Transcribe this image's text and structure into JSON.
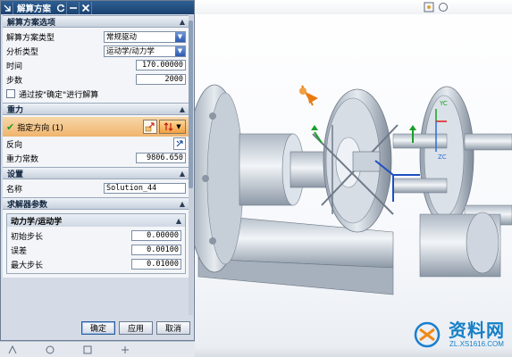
{
  "window": {
    "title": "解算方案"
  },
  "sections": {
    "solution_options": {
      "title": "解算方案选项",
      "solution_type": {
        "label": "解算方案类型",
        "value": "常规驱动"
      },
      "analysis_type": {
        "label": "分析类型",
        "value": "运动学/动力学"
      },
      "time": {
        "label": "时间",
        "value": "170.00000"
      },
      "steps": {
        "label": "步数",
        "value": "2000"
      },
      "confirm_solve": {
        "label": "通过按\"确定\"进行解算"
      }
    },
    "gravity": {
      "title": "重力",
      "specify_direction": {
        "label": "指定方向 (1)"
      },
      "reverse": {
        "label": "反向"
      },
      "gravity_constant": {
        "label": "重力常数",
        "value": "9806.650"
      }
    },
    "settings": {
      "title": "设置",
      "name": {
        "label": "名称",
        "value": "Solution_44"
      }
    },
    "solver_params": {
      "title": "求解器参数",
      "dyn_kin": {
        "title": "动力学/运动学",
        "initial_step": {
          "label": "初始步长",
          "value": "0.00000"
        },
        "error": {
          "label": "误差",
          "value": "0.00100"
        },
        "max_step": {
          "label": "最大步长",
          "value": "0.01000"
        }
      }
    }
  },
  "buttons": {
    "ok": "确定",
    "apply": "应用",
    "cancel": "取消"
  },
  "viewport": {
    "labels": {
      "yc": "YC",
      "zc": "ZC"
    }
  },
  "watermark": {
    "title": "资料网",
    "url": "ZL.XS1616.COM"
  },
  "icons": {
    "check": "check-icon",
    "vector": "vector-icon",
    "direction": "direction-icon",
    "reverse": "reverse-icon",
    "close": "close-icon",
    "minimize": "minimize-icon",
    "reset": "reset-icon"
  },
  "colors": {
    "title_bar": "#1b4271",
    "direction_highlight": "#f0b46d",
    "panel": "#d4dbe6",
    "axis_yc": "#18a028",
    "axis_zc": "#2a6fd6"
  }
}
